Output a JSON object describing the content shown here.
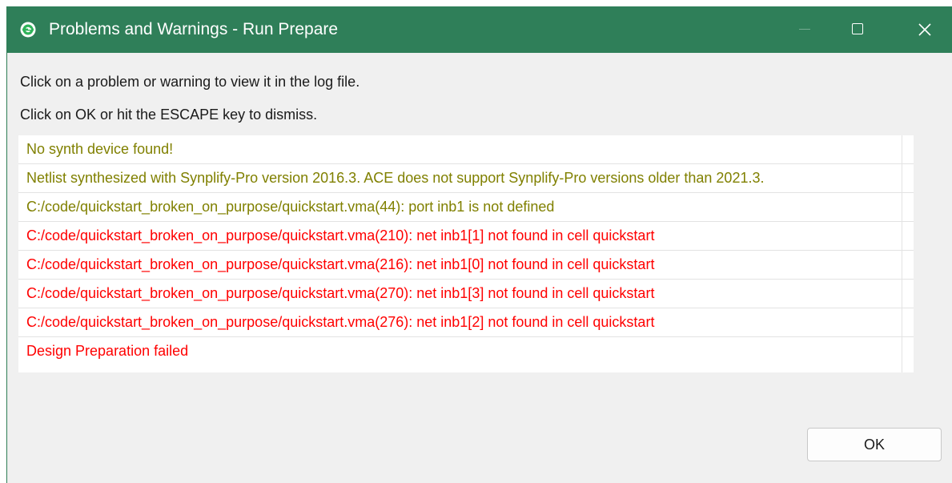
{
  "window": {
    "title": "Problems and Warnings - Run Prepare",
    "accent_color": "#2f7f59"
  },
  "instructions": [
    "Click on a problem or warning to view it in the log file.",
    "Click on OK or hit the ESCAPE key to dismiss."
  ],
  "messages": [
    {
      "text": "No synth device found!",
      "severity": "warning",
      "color": "#808000"
    },
    {
      "text": "Netlist synthesized with Synplify-Pro version 2016.3. ACE does not support Synplify-Pro versions older than 2021.3.",
      "severity": "warning",
      "color": "#808000"
    },
    {
      "text": "C:/code/quickstart_broken_on_purpose/quickstart.vma(44): port inb1 is not defined",
      "severity": "warning",
      "color": "#808000"
    },
    {
      "text": "C:/code/quickstart_broken_on_purpose/quickstart.vma(210): net inb1[1] not found in cell quickstart",
      "severity": "error",
      "color": "#ff0000"
    },
    {
      "text": "C:/code/quickstart_broken_on_purpose/quickstart.vma(216): net inb1[0] not found in cell quickstart",
      "severity": "error",
      "color": "#ff0000"
    },
    {
      "text": "C:/code/quickstart_broken_on_purpose/quickstart.vma(270): net inb1[3] not found in cell quickstart",
      "severity": "error",
      "color": "#ff0000"
    },
    {
      "text": "C:/code/quickstart_broken_on_purpose/quickstart.vma(276): net inb1[2] not found in cell quickstart",
      "severity": "error",
      "color": "#ff0000"
    },
    {
      "text": "Design Preparation failed",
      "severity": "error",
      "color": "#ff0000"
    }
  ],
  "buttons": {
    "ok_label": "OK"
  },
  "icons": {
    "app": "app-logo-icon",
    "minimize": "minimize-icon",
    "maximize": "maximize-icon",
    "close": "close-icon"
  }
}
